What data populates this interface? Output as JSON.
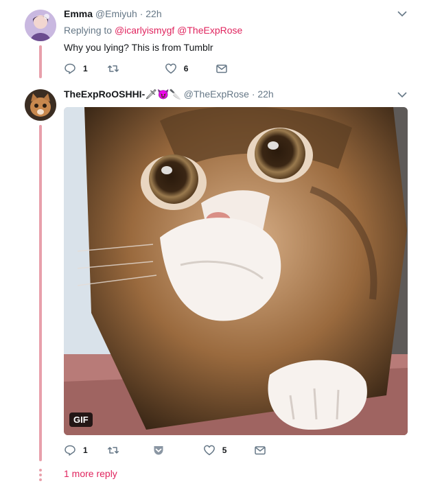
{
  "tweets": [
    {
      "name": "Emma",
      "handle": "@Emiyuh",
      "time": "· 22h",
      "replying_prefix": "Replying to",
      "replying_mentions": [
        "@icarlyismygf",
        "@TheExpRose"
      ],
      "text": "Why you lying? This is from Tumblr",
      "reply_count": "1",
      "like_count": "6"
    },
    {
      "name": "TheExpRoOSHHI-",
      "name_emoji": "🗡😈🔪",
      "handle": "@TheExpRose",
      "time": "· 22h",
      "media_badge": "GIF",
      "reply_count": "1",
      "like_count": "5"
    }
  ],
  "thread": {
    "more_replies": "1 more reply"
  },
  "colors": {
    "accent": "#e0245e",
    "thread_line": "#e8a0ab",
    "muted": "#657786"
  }
}
